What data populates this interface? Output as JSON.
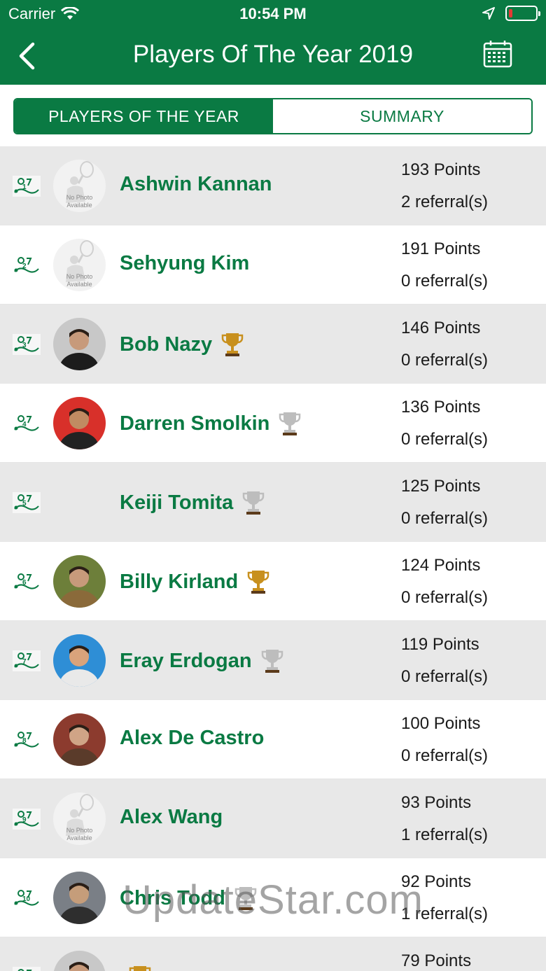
{
  "status_bar": {
    "carrier": "Carrier",
    "time": "10:54 PM",
    "battery_level": 0.12
  },
  "nav": {
    "title": "Players Of The Year 2019",
    "back_icon": "chevron-left-icon",
    "calendar_icon": "calendar-icon"
  },
  "tabs": [
    {
      "label": "PLAYERS OF THE YEAR",
      "active": true
    },
    {
      "label": "SUMMARY",
      "active": false
    }
  ],
  "colors": {
    "brand_green": "#0a7a43",
    "row_alt": "#e8e8e8",
    "trophy_gold": "#c8901e",
    "trophy_silver": "#bdbdbd"
  },
  "players": [
    {
      "rank": "1",
      "name": "Ashwin Kannan",
      "points": "193 Points",
      "referrals": "2 referral(s)",
      "photo": "no-photo",
      "photo_text": "No Photo Available",
      "trophy": "none"
    },
    {
      "rank": "2",
      "name": "Sehyung Kim",
      "points": "191 Points",
      "referrals": "0 referral(s)",
      "photo": "no-photo",
      "photo_text": "No Photo Available",
      "trophy": "none"
    },
    {
      "rank": "3",
      "name": "Bob Nazy",
      "points": "146 Points",
      "referrals": "0 referral(s)",
      "photo": "photo",
      "trophy": "gold"
    },
    {
      "rank": "4",
      "name": "Darren Smolkin",
      "points": "136 Points",
      "referrals": "0 referral(s)",
      "photo": "photo",
      "trophy": "silver"
    },
    {
      "rank": "5",
      "name": "Keiji Tomita",
      "points": "125 Points",
      "referrals": "0 referral(s)",
      "photo": "none",
      "trophy": "silver"
    },
    {
      "rank": "6",
      "name": "Billy Kirland",
      "points": "124 Points",
      "referrals": "0 referral(s)",
      "photo": "photo",
      "trophy": "gold"
    },
    {
      "rank": "7",
      "name": "Eray Erdogan",
      "points": "119 Points",
      "referrals": "0 referral(s)",
      "photo": "photo",
      "trophy": "silver"
    },
    {
      "rank": "8",
      "name": "Alex De Castro",
      "points": "100 Points",
      "referrals": "0 referral(s)",
      "photo": "photo",
      "trophy": "none"
    },
    {
      "rank": "9",
      "name": "Alex Wang",
      "points": "93 Points",
      "referrals": "1 referral(s)",
      "photo": "no-photo",
      "photo_text": "No Photo Available",
      "trophy": "none"
    },
    {
      "rank": "10",
      "name": "Chris Todd",
      "points": "92 Points",
      "referrals": "1 referral(s)",
      "photo": "photo",
      "trophy": "silver"
    },
    {
      "rank": "11",
      "name": "",
      "points": "79 Points",
      "referrals": "",
      "photo": "photo",
      "trophy": "gold"
    }
  ],
  "watermark": "UpdateStar.com"
}
